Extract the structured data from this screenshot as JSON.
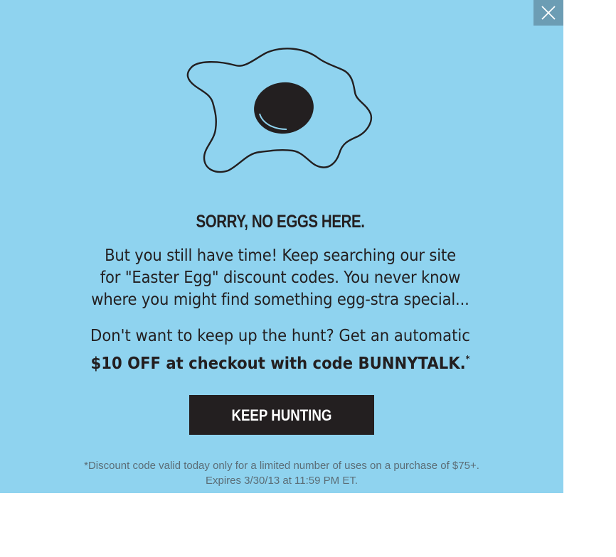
{
  "modal": {
    "close_icon": "close-icon",
    "illustration_icon": "fried-egg-icon",
    "title": "SORRY, NO EGGS HERE.",
    "body_lines": [
      "But you still have time! Keep searching our site",
      "for \"Easter Egg\" discount codes. You never know",
      "where you might find something egg-stra special..."
    ],
    "promo_line_1": "Don't want to keep up the hunt? Get an automatic",
    "promo_line_2": "$10 OFF at checkout with code BUNNYTALK.",
    "promo_footnote_mark": "*",
    "cta_label": "KEEP HUNTING",
    "disclaimer_lines": [
      "*Discount code valid today only for a limited number of uses on a purchase of $75+.",
      "Expires 3/30/13 at 11:59 PM ET."
    ]
  },
  "colors": {
    "background": "#8fd3ef",
    "close_button": "#6c9db4",
    "text": "#231f20",
    "cta_background": "#231f20",
    "cta_text": "#ffffff",
    "disclaimer_text": "#5b6d76"
  }
}
